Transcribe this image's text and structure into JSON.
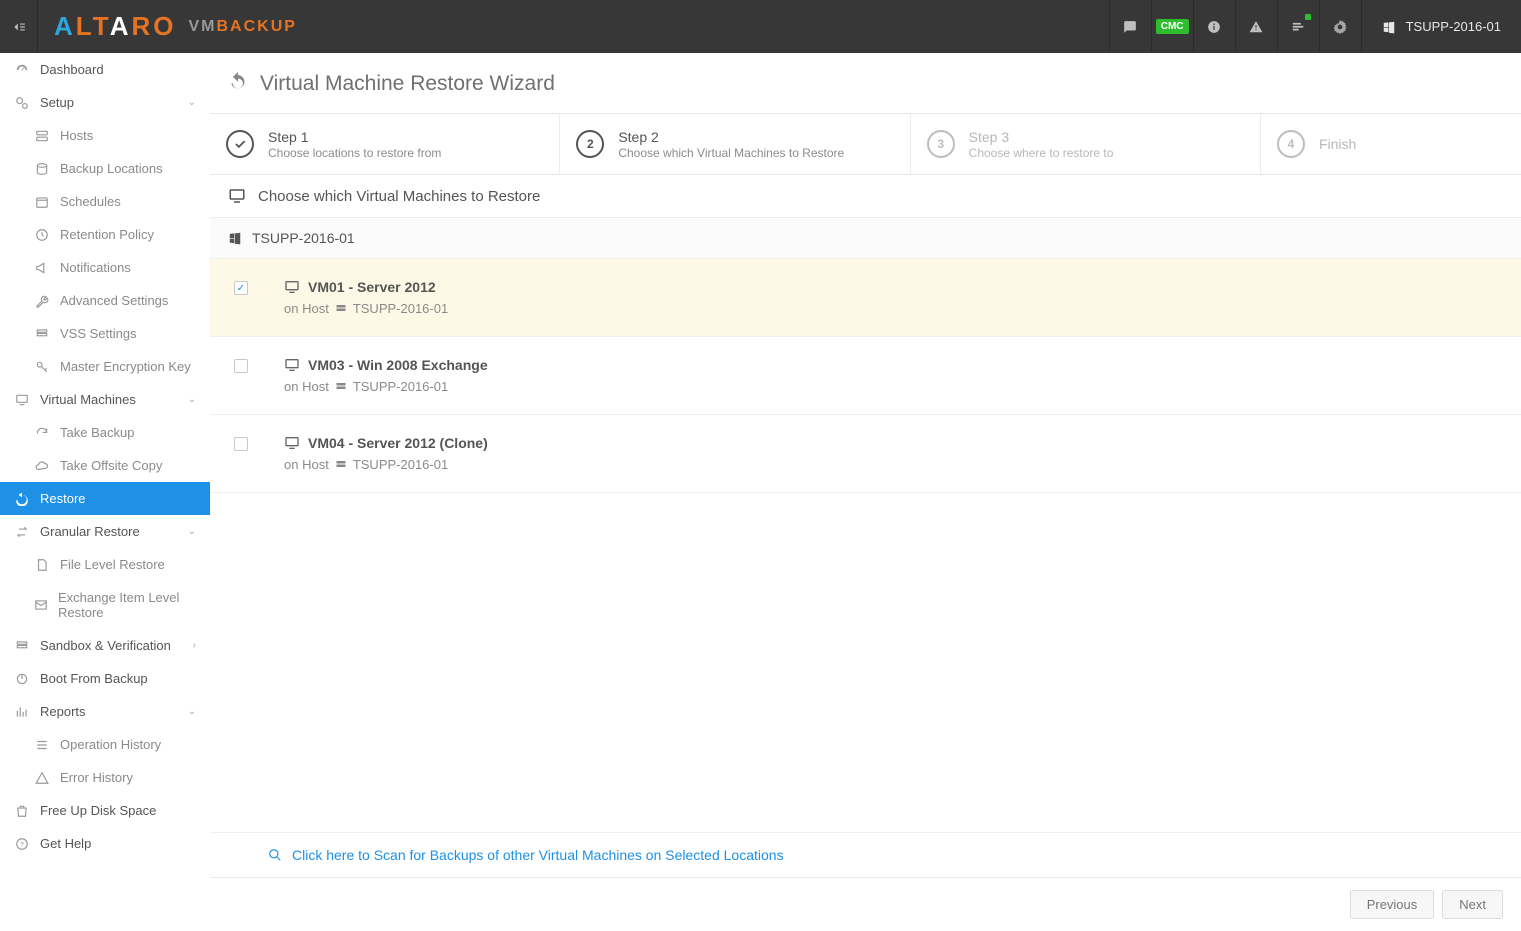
{
  "header": {
    "server": "TSUPP-2016-01",
    "cmc": "CMC"
  },
  "sidebar": {
    "dashboard": "Dashboard",
    "setup": "Setup",
    "hosts": "Hosts",
    "backup_locations": "Backup Locations",
    "schedules": "Schedules",
    "retention_policy": "Retention Policy",
    "notifications": "Notifications",
    "advanced_settings": "Advanced Settings",
    "vss_settings": "VSS Settings",
    "master_encryption": "Master Encryption Key",
    "virtual_machines": "Virtual Machines",
    "take_backup": "Take Backup",
    "take_offsite": "Take Offsite Copy",
    "restore": "Restore",
    "granular_restore": "Granular Restore",
    "file_level_restore": "File Level Restore",
    "exchange_item_restore": "Exchange Item Level Restore",
    "sandbox": "Sandbox & Verification",
    "boot_from_backup": "Boot From Backup",
    "reports": "Reports",
    "operation_history": "Operation History",
    "error_history": "Error History",
    "free_up": "Free Up Disk Space",
    "get_help": "Get Help"
  },
  "main": {
    "title": "Virtual Machine Restore Wizard",
    "steps": {
      "s1_t": "Step 1",
      "s1_s": "Choose locations to restore from",
      "s2_t": "Step 2",
      "s2_s": "Choose which Virtual Machines to Restore",
      "s3_t": "Step 3",
      "s3_s": "Choose where to restore to",
      "s4_t": "Finish"
    },
    "subtitle": "Choose which Virtual Machines to Restore",
    "host_group": "TSUPP-2016-01",
    "vms": [
      {
        "name": "VM01 - Server 2012",
        "on_host_label": "on Host",
        "host": "TSUPP-2016-01",
        "checked": true
      },
      {
        "name": "VM03 - Win 2008 Exchange",
        "on_host_label": "on Host",
        "host": "TSUPP-2016-01",
        "checked": false
      },
      {
        "name": "VM04 - Server 2012 (Clone)",
        "on_host_label": "on Host",
        "host": "TSUPP-2016-01",
        "checked": false
      }
    ],
    "scan_link": "Click here to Scan for Backups of other Virtual Machines on Selected Locations",
    "previous": "Previous",
    "next": "Next"
  }
}
